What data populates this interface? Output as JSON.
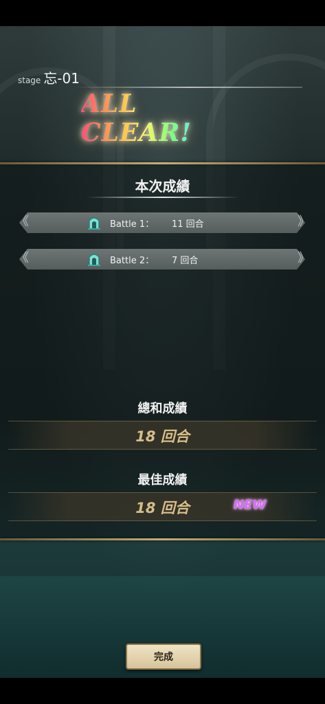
{
  "stage": {
    "prefix": "stage",
    "number": "忘-01"
  },
  "banner": {
    "text": "ALL CLEAR!"
  },
  "current_results": {
    "title": "本次成績",
    "battles": [
      {
        "name": "Battle 1：",
        "value": "11 回合",
        "icon": "gate-icon"
      },
      {
        "name": "Battle 2：",
        "value": "7 回合",
        "icon": "gate-icon"
      }
    ]
  },
  "total": {
    "title": "總和成績",
    "value": "18 回合"
  },
  "best": {
    "title": "最佳成績",
    "value": "18 回合",
    "badge": "NEW"
  },
  "done_button": {
    "label": "完成"
  },
  "colors": {
    "gold": "#c6ad7a",
    "result_text": "#d8bd8a",
    "new_badge": "#d46bff"
  }
}
